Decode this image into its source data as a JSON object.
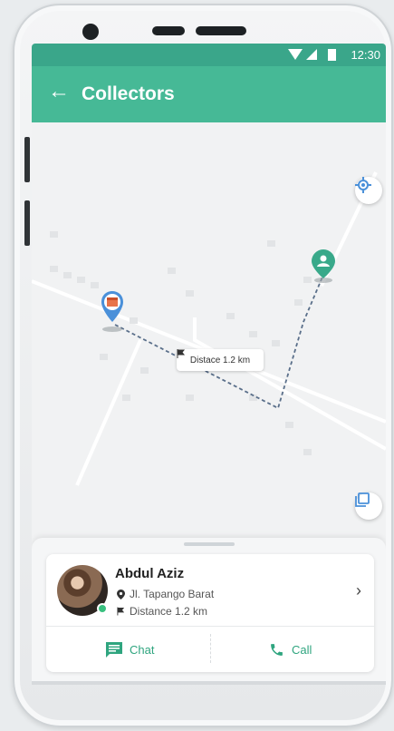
{
  "status_bar": {
    "time": "12:30"
  },
  "app_bar": {
    "title": "Collectors"
  },
  "map": {
    "distance_label": "Distace 1.2 km"
  },
  "collector": {
    "name": "Abdul Aziz",
    "address": "Jl. Tapango Barat",
    "distance": "Distance 1.2 km"
  },
  "actions": {
    "chat": "Chat",
    "call": "Call"
  },
  "colors": {
    "primary": "#46b996",
    "accent_dark": "#3aa68a",
    "route": "#5a6f8a",
    "online": "#39c07f"
  }
}
